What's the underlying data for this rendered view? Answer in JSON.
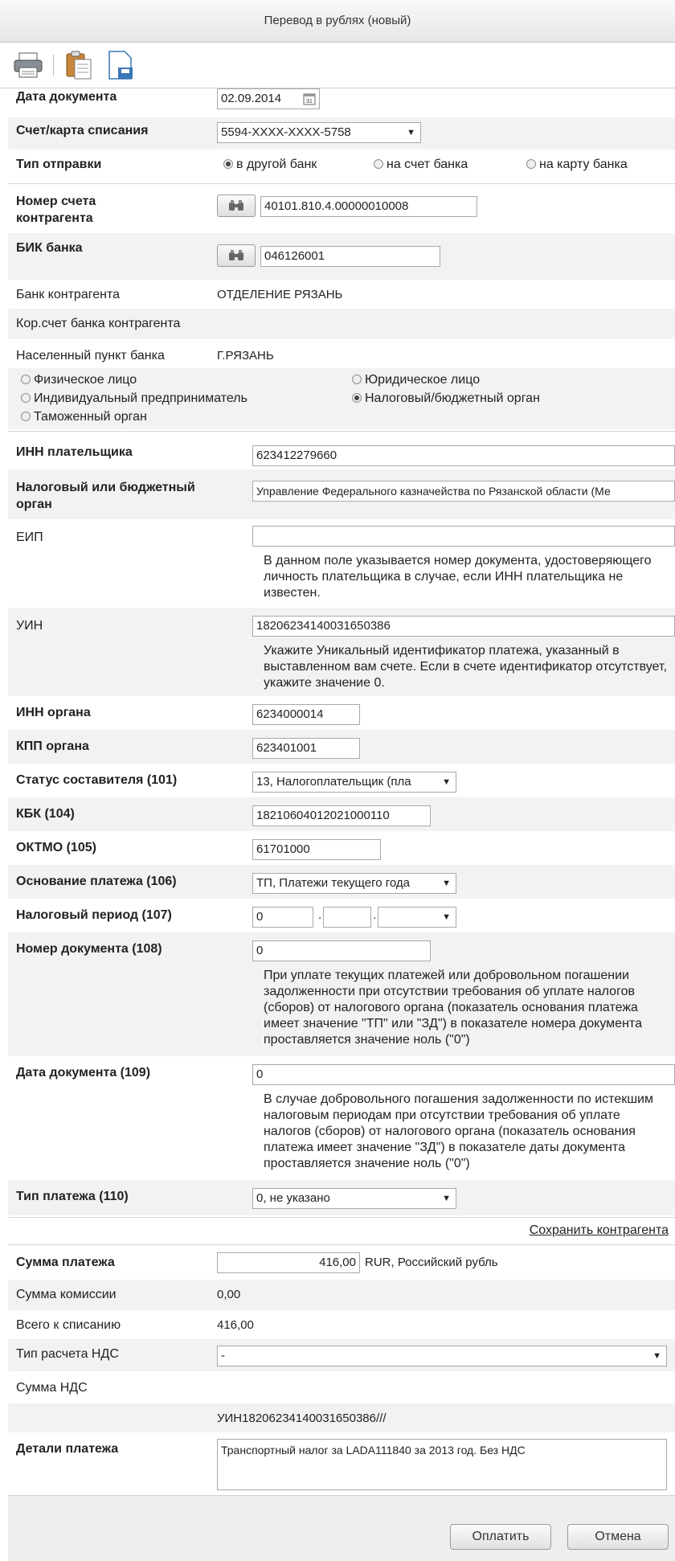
{
  "window": {
    "title": "Перевод в рублях (новый)"
  },
  "toolbar": {
    "icons": [
      "printer-icon",
      "clipboard-icon",
      "save-icon"
    ]
  },
  "form": {
    "doc_date": {
      "label": "Дата документа",
      "value": "02.09.2014"
    },
    "account": {
      "label": "Счет/карта списания",
      "value": "5594-XXXX-XXXX-5758"
    },
    "send_type": {
      "label": "Тип отправки",
      "options": [
        "в другой банк",
        "на счет банка",
        "на карту банка"
      ]
    },
    "acc_number": {
      "label_1": "Номер счета",
      "label_2": "контрагента",
      "value": "40101.810.4.00000010008"
    },
    "bik": {
      "label": "БИК банка",
      "value": "046126001"
    },
    "bank": {
      "label": "Банк контрагента",
      "value": "ОТДЕЛЕНИЕ РЯЗАНЬ"
    },
    "corr": {
      "label": "Кор.счет банка контрагента",
      "value": ""
    },
    "city": {
      "label": "Населенный пункт банка",
      "value": "Г.РЯЗАНЬ"
    },
    "recipient_types": [
      "Физическое лицо",
      "Юридическое лицо",
      "Индивидуальный предприниматель",
      "Налоговый/бюджетный орган",
      "Таможенный орган"
    ],
    "inn_payer": {
      "label": "ИНН плательщика",
      "value": "623412279660"
    },
    "organ": {
      "label_1": "Налоговый или бюджетный",
      "label_2": "орган",
      "value": "Управление Федерального казначейства по Рязанской области (Ме"
    },
    "eip": {
      "label": "ЕИП",
      "value": "",
      "hint": "В данном поле указывается номер документа, удостоверяющего личность плательщика в случае, если ИНН плательщика не известен."
    },
    "uin": {
      "label": "УИН",
      "value": "18206234140031650386",
      "hint": "Укажите Уникальный идентификатор платежа, указанный в выставленном вам счете. Если в счете идентификатор отсутствует, укажите значение 0."
    },
    "inn_organ": {
      "label": "ИНН органа",
      "value": "6234000014"
    },
    "kpp": {
      "label": "КПП органа",
      "value": "623401001"
    },
    "status": {
      "label": "Статус составителя (101)",
      "value": "13, Налогоплательщик (пла"
    },
    "kbk": {
      "label": "КБК (104)",
      "value": "18210604012021000110"
    },
    "oktmo": {
      "label": "ОКТМО (105)",
      "value": "61701000"
    },
    "basis": {
      "label": "Основание платежа (106)",
      "value": "ТП, Платежи текущего года"
    },
    "period": {
      "label": "Налоговый период (107)",
      "value": "0"
    },
    "doc_number": {
      "label": "Номер документа (108)",
      "value": "0",
      "hint": "При уплате текущих платежей или добровольном погашении задолженности при отсутствии требования об уплате налогов (сборов) от налогового органа (показатель основания платежа имеет значение \"ТП\" или \"ЗД\") в показателе номера документа проставляется значение ноль (\"0\")"
    },
    "doc_date109": {
      "label": "Дата документа (109)",
      "value": "0",
      "hint": "В случае добровольного погашения задолженности по истекшим налоговым периодам при отсутствии требования об уплате налогов (сборов) от налогового органа (показатель основания платежа имеет значение \"ЗД\") в показателе даты документа проставляется значение ноль (\"0\")"
    },
    "pay_type": {
      "label": "Тип платежа (110)",
      "value": "0, не указано"
    },
    "save_contractor": "Сохранить контрагента",
    "amount": {
      "label": "Сумма платежа",
      "value": "416,00",
      "currency": "RUR, Российский рубль"
    },
    "commission": {
      "label": "Сумма комиссии",
      "value": "0,00"
    },
    "total": {
      "label": "Всего к списанию",
      "value": "416,00"
    },
    "vat_type": {
      "label": "Тип расчета НДС",
      "value": "-"
    },
    "vat_sum": {
      "label": "Сумма НДС",
      "value": ""
    },
    "uin_line": "УИН18206234140031650386///",
    "details": {
      "label": "Детали платежа",
      "value": "Транспортный налог за LADA111840 за 2013 год. Без НДС"
    }
  },
  "buttons": {
    "pay": "Оплатить",
    "cancel": "Отмена"
  }
}
